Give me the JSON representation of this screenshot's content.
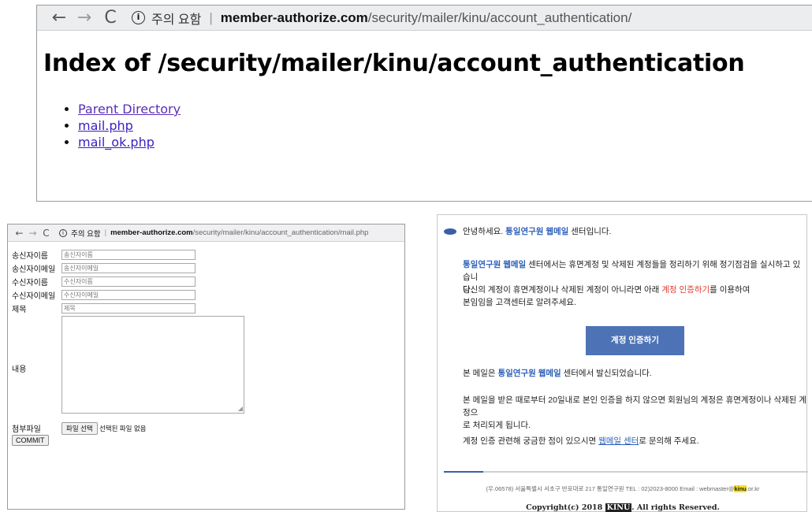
{
  "top_browser": {
    "back": "←",
    "forward": "→",
    "reload": "C",
    "info": "i",
    "warning": "주의 요함",
    "host": "member-authorize.com",
    "path": "/security/mailer/kinu/account_authentication/",
    "heading": "Index of /security/mailer/kinu/account_authentication",
    "links": [
      "Parent Directory",
      "mail.php",
      "mail_ok.php"
    ]
  },
  "mail_form_browser": {
    "back": "←",
    "forward": "→",
    "reload": "C",
    "info": "i",
    "warning": "주의 요함",
    "host": "member-authorize.com",
    "path": "/security/mailer/kinu/account_authentication/mail.php",
    "fields": [
      {
        "label": "송신자이름",
        "placeholder": "송신자이름"
      },
      {
        "label": "송신자이메일",
        "placeholder": "송신자이메일"
      },
      {
        "label": "수신자이름",
        "placeholder": "수신자이름"
      },
      {
        "label": "수신자이메일",
        "placeholder": "수신자이메일"
      },
      {
        "label": "제목",
        "placeholder": "제목"
      }
    ],
    "content_label": "내용",
    "attach_label": "첨부파일",
    "file_button": "파일 선택",
    "file_status": "선택된 파일 없음",
    "submit": "COMMIT"
  },
  "email": {
    "greeting_pre": "안녕하세요. ",
    "greeting_brand": "통일연구원 웹메일",
    "greeting_post": " 센터입니다.",
    "p1_brand": "통일연구원 웹메일",
    "p1_line1": " 센터에서는 휴면계정 및 삭제된 계정들을 정리하기 위해 정기점검을 실시하고 있습니",
    "p1_line2": "다.",
    "p2_line1_pre": "당신의 계정이 휴면계정이나 삭제된 계정이 아니라면 아래 ",
    "p2_line1_red": "계정 인증하기",
    "p2_line1_post": "를 이용하여",
    "p2_line2": "본임임을 고객센터로 알려주세요.",
    "button": "계정 인증하기",
    "p3_pre": "본 메일은 ",
    "p3_brand": "통일연구원 웹메일",
    "p3_post": " 센터에서 발신되었습니다.",
    "p4_line1": "본 메일을 받은 때로부터 20일내로 본인 인증을 하지 않으면 회원님의 계정은 휴면계정이나 삭제된 계정으",
    "p4_line2": "로 처리되게 됩니다.",
    "p5_pre": "계정 인증 관련해 궁금한 점이 있으시면 ",
    "p5_link": "웹메일 센터",
    "p5_post": "로 문의해 주세요.",
    "footer_pre": "(우.06578) 서울특별시 서초구 반포대로 217 통일연구원 TEL : 02)2023-8000 Email : webmaster@",
    "footer_hl": "kinu",
    "footer_post": ".or.kr",
    "copyright_pre": "Copyright(c) 2018 ",
    "copyright_brand": "KINU",
    "copyright_post": ". All rights Reserved."
  },
  "colors": {
    "link": "#3b1ec2",
    "brand_blue": "#2c5fb8",
    "button": "#4d73b6",
    "alert_red": "#e03a2c"
  }
}
